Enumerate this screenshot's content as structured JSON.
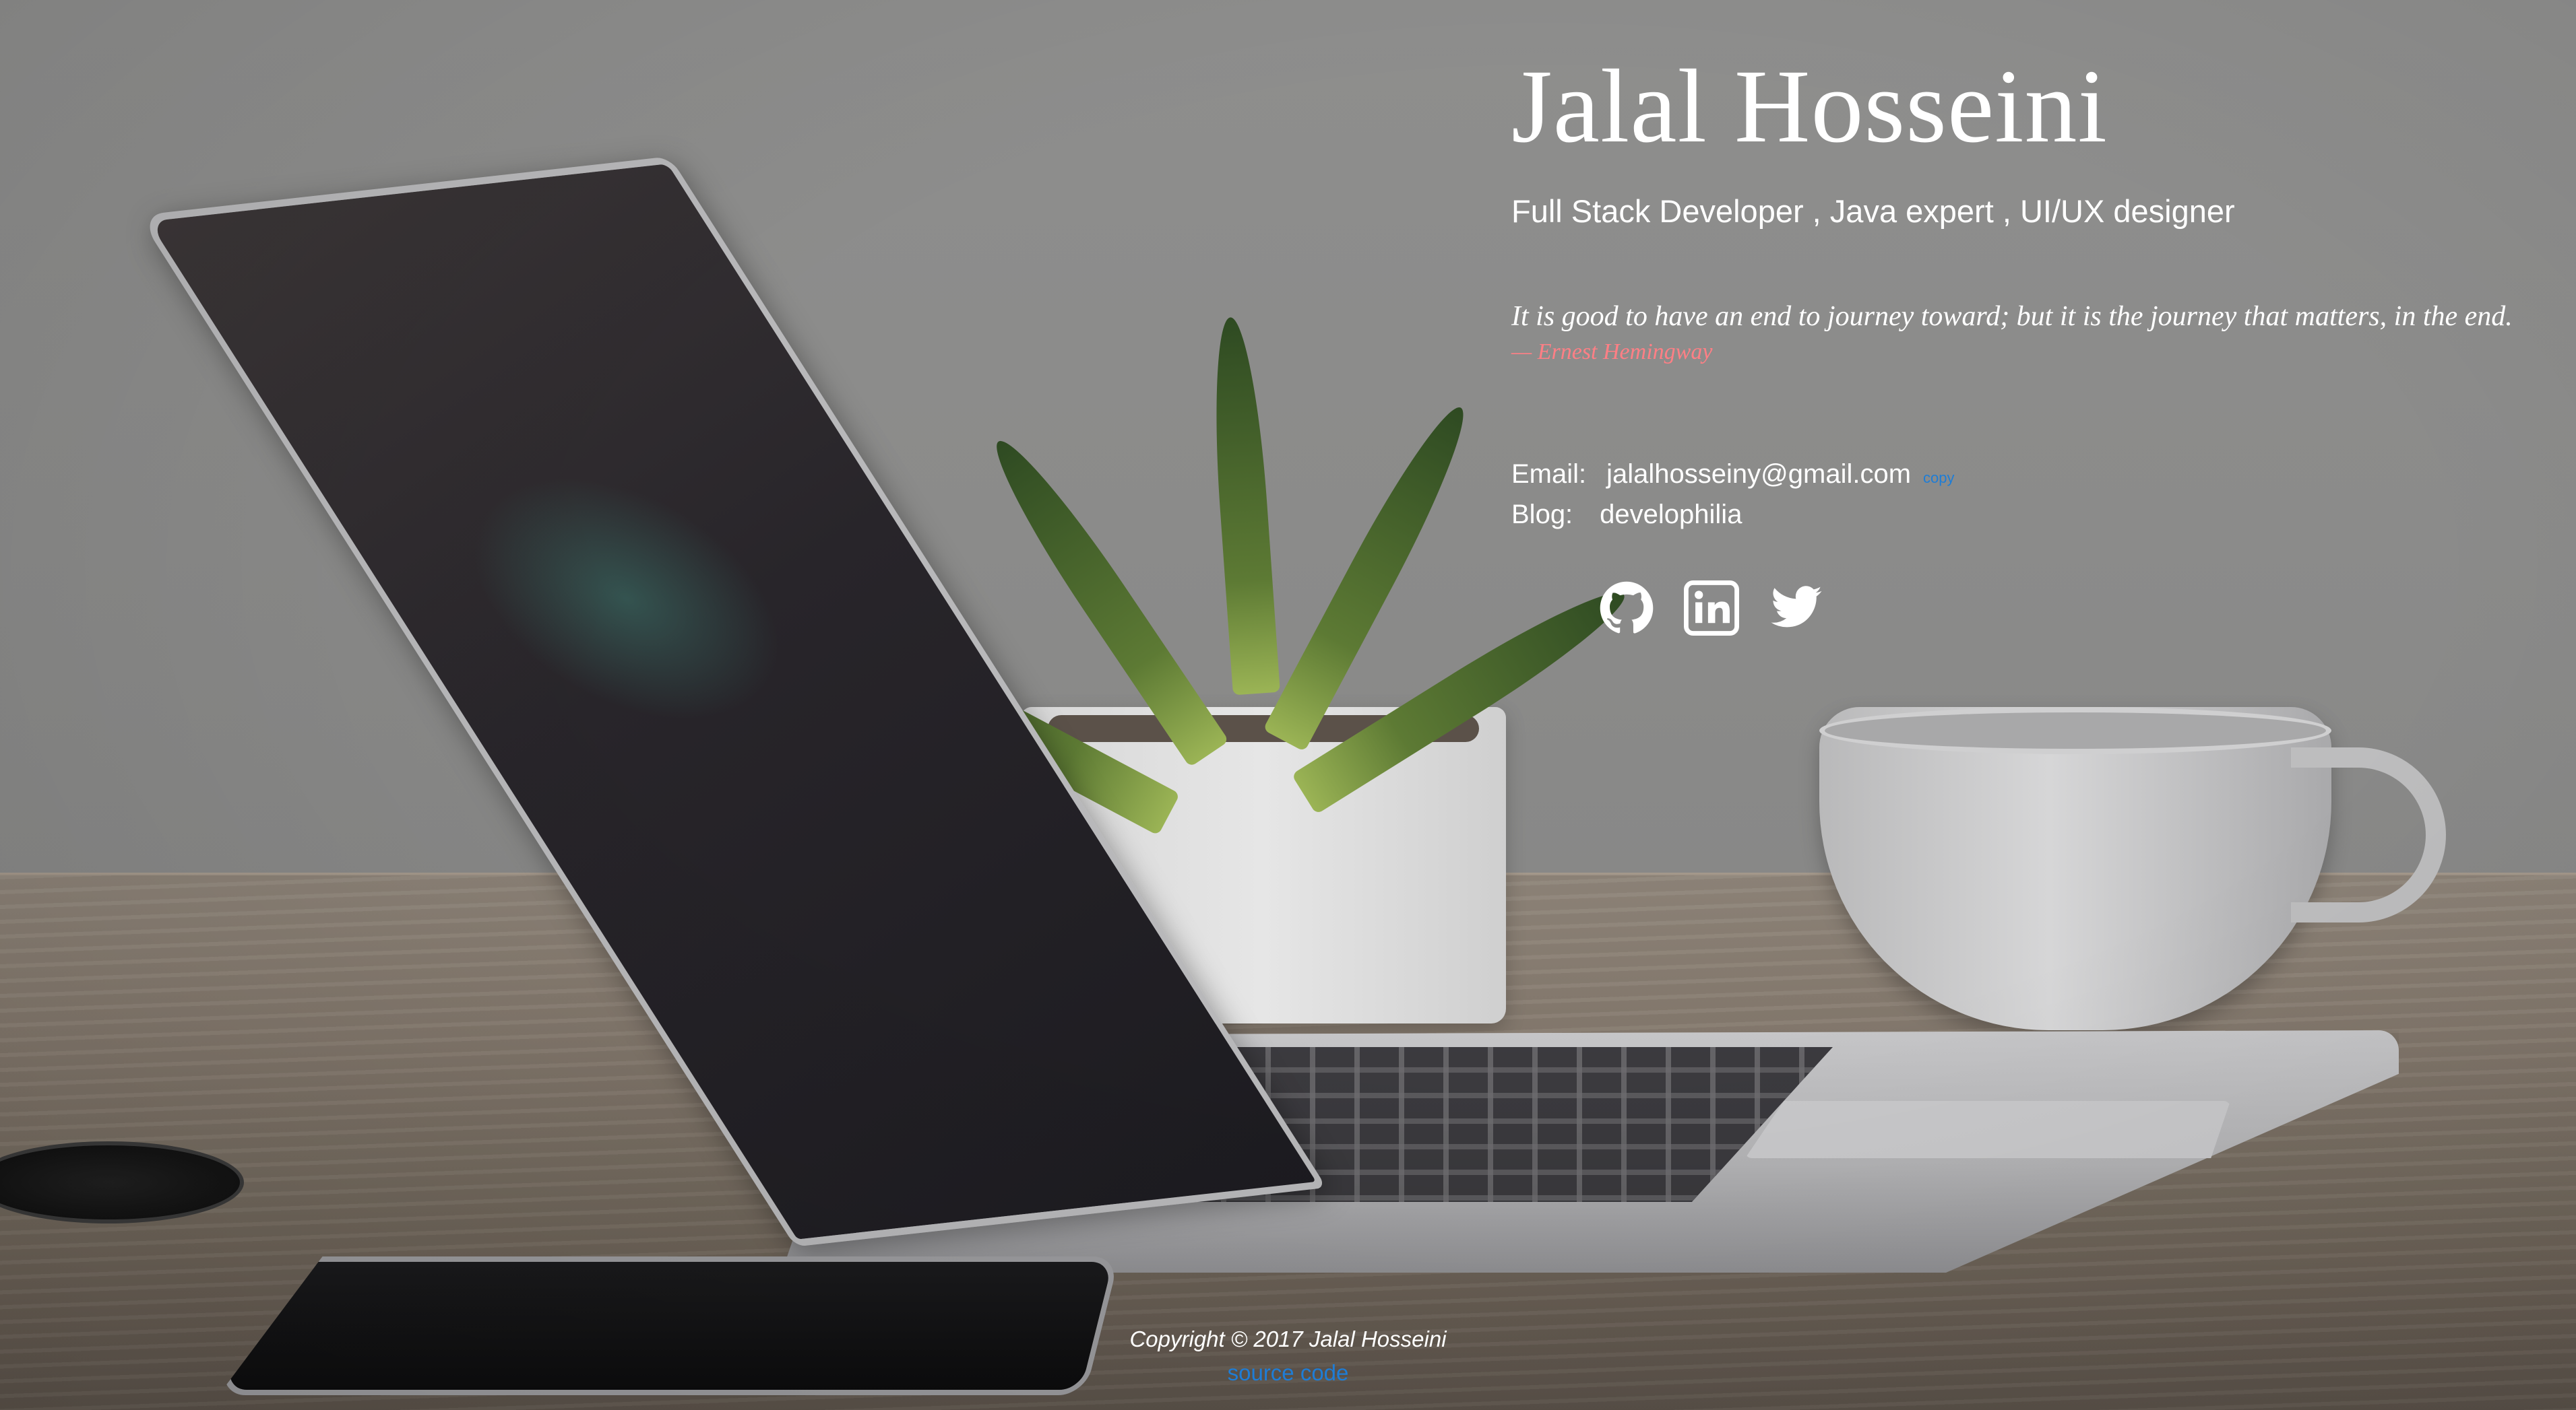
{
  "profile": {
    "name": "Jalal Hosseini",
    "subtitle": "Full Stack Developer , Java expert , UI/UX designer"
  },
  "quote": {
    "text": "It is good to have an end to journey toward; but it is the journey that matters, in the end.",
    "author": "— Ernest Hemingway"
  },
  "contact": {
    "email_label": "Email:",
    "email_value": "jalalhosseiny@gmail.com",
    "copy_label": "copy",
    "blog_label": "Blog:",
    "blog_value": "develophilia"
  },
  "social": [
    {
      "icon": "github-icon"
    },
    {
      "icon": "linkedin-icon"
    },
    {
      "icon": "twitter-icon"
    }
  ],
  "footer": {
    "copyright": "Copyright © 2017 Jalal Hosseini",
    "source_label": "source code"
  },
  "colors": {
    "text": "#ffffff",
    "author_accent": "#ff7f85",
    "link": "#1e7dd6"
  }
}
